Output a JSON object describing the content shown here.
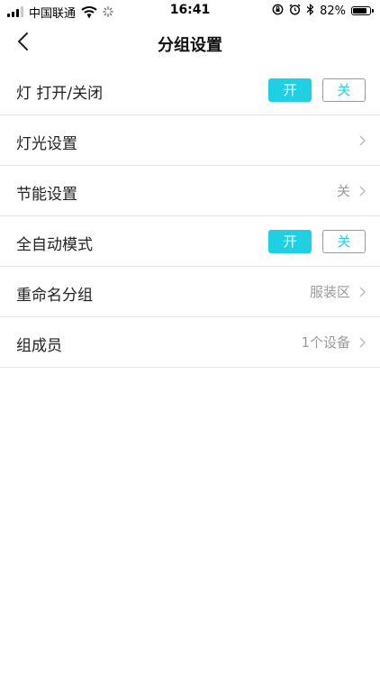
{
  "status_bar": {
    "carrier": "中国联通",
    "time": "16:41",
    "battery_percent": "82%",
    "battery_level": 0.82
  },
  "nav": {
    "title": "分组设置",
    "back_icon": "chevron-left-icon"
  },
  "rows": [
    {
      "label": "灯 打开/关闭",
      "type": "toggle",
      "on_label": "开",
      "off_label": "关",
      "selected": "on"
    },
    {
      "label": "灯光设置",
      "type": "link",
      "value": ""
    },
    {
      "label": "节能设置",
      "type": "link",
      "value": "关"
    },
    {
      "label": "全自动模式",
      "type": "toggle",
      "on_label": "开",
      "off_label": "关",
      "selected": "on"
    },
    {
      "label": "重命名分组",
      "type": "link",
      "value": "服装区"
    },
    {
      "label": "组成员",
      "type": "link",
      "value": "1个设备"
    }
  ],
  "colors": {
    "accent": "#1fcfe2",
    "divider": "#e3e3e3",
    "secondary_text": "#9a9a9a"
  }
}
